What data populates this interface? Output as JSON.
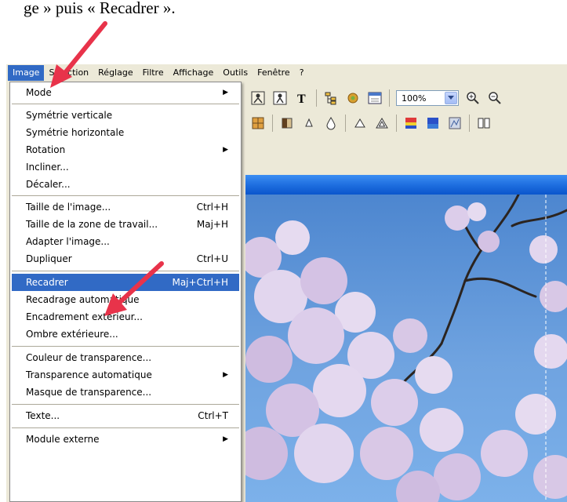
{
  "doc_text": "ge » puis « Recadrer ».",
  "menubar": [
    "Image",
    "Sélection",
    "Réglage",
    "Filtre",
    "Affichage",
    "Outils",
    "Fenêtre",
    "?"
  ],
  "toolbar": {
    "zoom_value": "100%"
  },
  "menu": {
    "items": [
      {
        "label": "Mode",
        "shortcut": "",
        "submenu": true
      },
      {
        "label": "Symétrie verticale",
        "shortcut": "",
        "submenu": false
      },
      {
        "label": "Symétrie horizontale",
        "shortcut": "",
        "submenu": false
      },
      {
        "label": "Rotation",
        "shortcut": "",
        "submenu": true
      },
      {
        "label": "Incliner...",
        "shortcut": "",
        "submenu": false
      },
      {
        "label": "Décaler...",
        "shortcut": "",
        "submenu": false
      },
      {
        "label": "Taille de l'image...",
        "shortcut": "Ctrl+H",
        "submenu": false
      },
      {
        "label": "Taille de la zone de travail...",
        "shortcut": "Maj+H",
        "submenu": false
      },
      {
        "label": "Adapter l'image...",
        "shortcut": "",
        "submenu": false
      },
      {
        "label": "Dupliquer",
        "shortcut": "Ctrl+U",
        "submenu": false
      },
      {
        "label": "Recadrer",
        "shortcut": "Maj+Ctrl+H",
        "submenu": false,
        "highlighted": true
      },
      {
        "label": "Recadrage automatique",
        "shortcut": "",
        "submenu": false
      },
      {
        "label": "Encadrement extérieur...",
        "shortcut": "",
        "submenu": false
      },
      {
        "label": "Ombre extérieure...",
        "shortcut": "",
        "submenu": false
      },
      {
        "label": "Couleur de transparence...",
        "shortcut": "",
        "submenu": false
      },
      {
        "label": "Transparence automatique",
        "shortcut": "",
        "submenu": true
      },
      {
        "label": "Masque de transparence...",
        "shortcut": "",
        "submenu": false
      },
      {
        "label": "Texte...",
        "shortcut": "Ctrl+T",
        "submenu": false
      },
      {
        "label": "Module externe",
        "shortcut": "",
        "submenu": true
      }
    ]
  },
  "colors": {
    "highlight": "#316ac5",
    "arrow": "#e8334a",
    "sky": "#6fa3e0",
    "blossom": "#d9c8e6"
  }
}
